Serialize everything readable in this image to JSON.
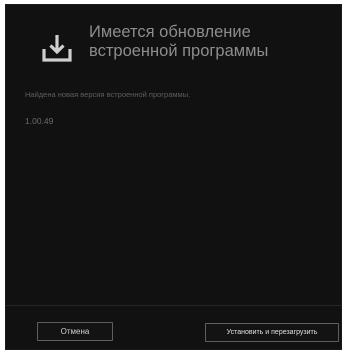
{
  "dialog": {
    "title": "Имеется обновление встроенной программы",
    "description": "Найдена новая версия встроенной программы.",
    "version": "1.00.49",
    "icon": "download-tray-icon"
  },
  "buttons": {
    "cancel_label": "Отмена",
    "install_label": "Установить и перезагрузить"
  },
  "colors": {
    "background": "#111111",
    "title_text": "#8d8d8d",
    "body_text": "#5e5e5e",
    "button_border": "#5f5f5f"
  }
}
